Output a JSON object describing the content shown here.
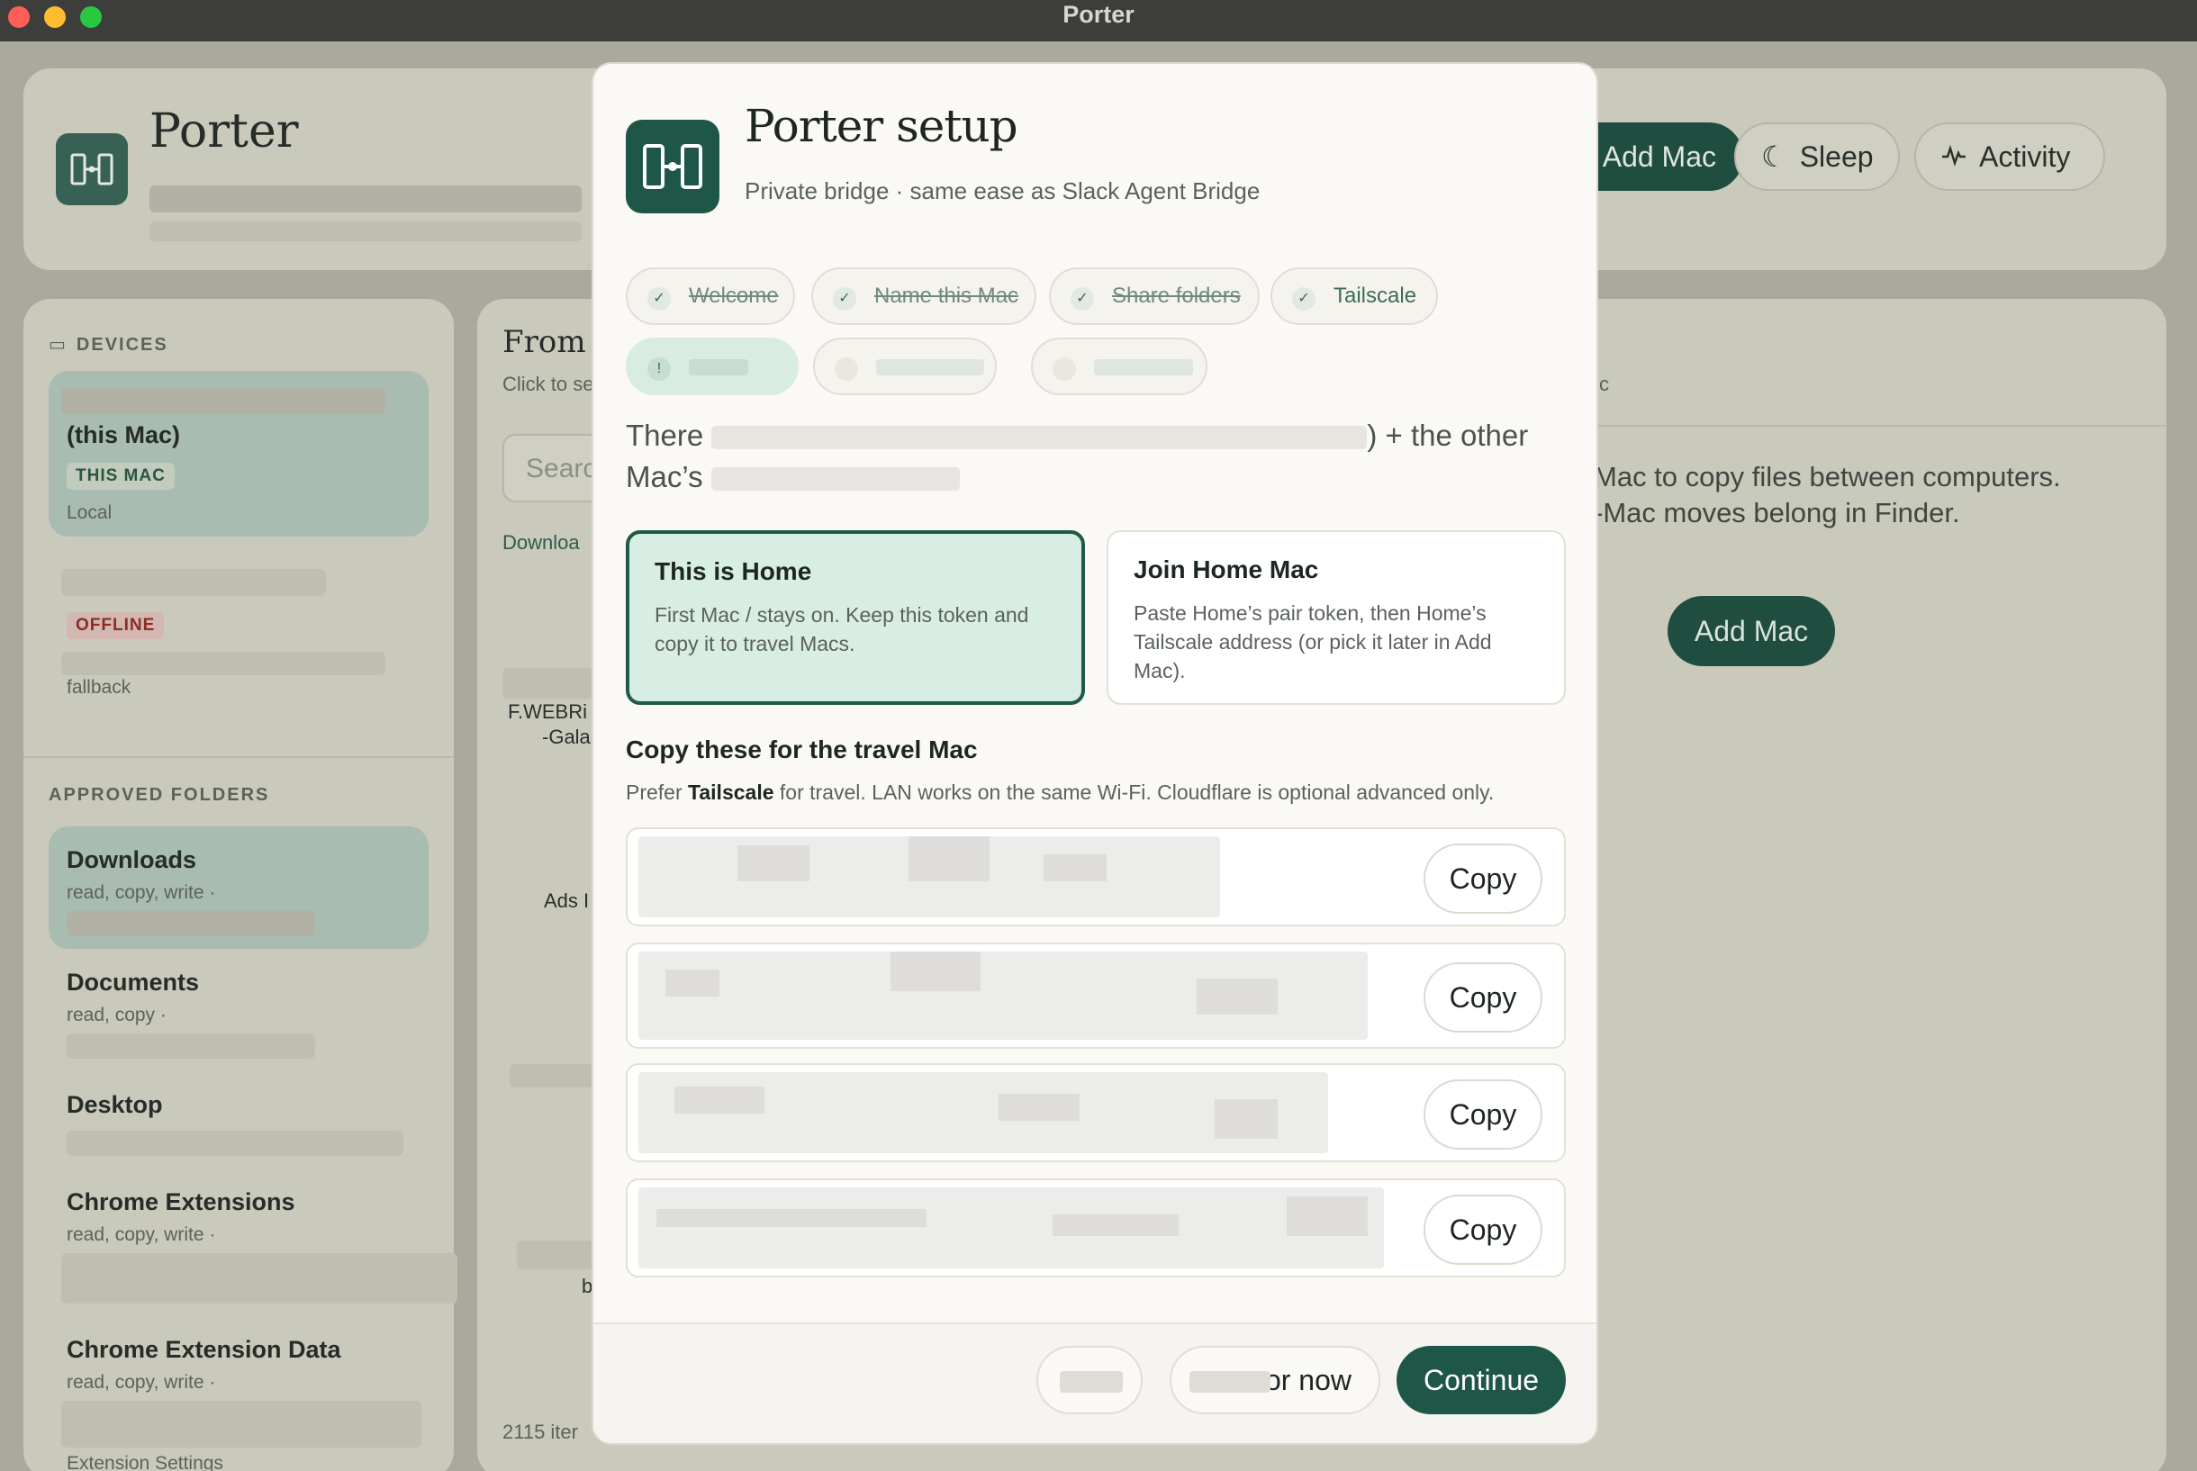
{
  "window": {
    "title": "Porter"
  },
  "app": {
    "name": "Porter",
    "header_buttons": {
      "add_mac": "Add Mac",
      "sleep": "Sleep",
      "activity": "Activity"
    },
    "sidebar": {
      "devices_label": "DEVICES",
      "devices": [
        {
          "name": "(this Mac)",
          "badge": "THIS MAC",
          "sub": "Local"
        },
        {
          "badge": "OFFLINE",
          "sub": "fallback"
        }
      ],
      "folders_label": "APPROVED FOLDERS",
      "folders": [
        {
          "name": "Downloads",
          "perm": "read, copy, write ·"
        },
        {
          "name": "Documents",
          "perm": "read, copy ·"
        },
        {
          "name": "Desktop",
          "perm": ""
        },
        {
          "name": "Chrome Extensions",
          "perm": "read, copy, write ·"
        },
        {
          "name": "Chrome Extension Data",
          "perm": "read, copy, write ·",
          "note": "Extension Settings"
        }
      ]
    },
    "main": {
      "title": "From · (",
      "hint": "Click to se",
      "search_placeholder": "Searc",
      "col_label": "Downloa",
      "item_1": "F.WEBRi",
      "item_1b": "-Gala",
      "item_2": "Ads I",
      "item_3": "b",
      "count": "2115 iter",
      "right_hint": "c",
      "empty_line1": "Mac to copy files between computers.",
      "empty_line2": "-Mac moves belong in Finder.",
      "empty_button": "Add Mac"
    }
  },
  "modal": {
    "title": "Porter setup",
    "subtitle": "Private bridge · same ease as Slack Agent Bridge",
    "steps": [
      {
        "label": "Welcome",
        "done": true
      },
      {
        "label": "Name this Mac",
        "done": true
      },
      {
        "label": "Share folders",
        "done": true
      },
      {
        "label": "Tailscale",
        "done": true
      }
    ],
    "intro_start": "There",
    "intro_mid": ") + the other",
    "intro_end": "Mac’s",
    "modes": [
      {
        "title": "This is Home",
        "desc": "First Mac / stays on. Keep this token and copy it to travel Macs.",
        "selected": true
      },
      {
        "title": "Join Home Mac",
        "desc": "Paste Home’s pair token, then Home’s Tailscale address (or pick it later in Add Mac).",
        "selected": false
      }
    ],
    "copy_heading": "Copy these for the travel Mac",
    "copy_prefer": "Prefer ",
    "copy_tailscale": "Tailscale",
    "copy_rest": " for travel. LAN works on the same Wi-Fi. Cloudflare is optional advanced only.",
    "copy_label": "Copy",
    "footer": {
      "skip_tail": "or now",
      "continue": "Continue"
    },
    "colors": {
      "accent": "#1e5747",
      "selected_bg": "#d8ede4"
    }
  }
}
